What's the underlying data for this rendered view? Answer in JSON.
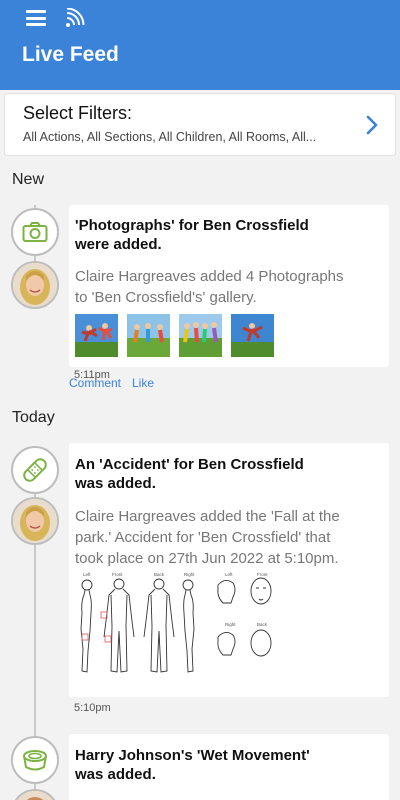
{
  "header": {
    "title": "Live Feed"
  },
  "filters": {
    "title": "Select Filters:",
    "summary": "All Actions, All Sections, All Children, All Rooms, All..."
  },
  "sections": {
    "new": "New",
    "today": "Today"
  },
  "feed": [
    {
      "title_line1": "'Photographs' for Ben Crossfield",
      "title_line2": "were added.",
      "text_line1": "Claire Hargreaves added 4 Photographs",
      "text_line2": "to 'Ben Crossfield's' gallery.",
      "time": "5:11pm",
      "comment_label": "Comment",
      "like_label": "Like"
    },
    {
      "title_line1": "An 'Accident' for Ben Crossfield",
      "title_line2": "was added.",
      "text_line1": "Claire Hargreaves added the 'Fall at the",
      "text_line2": "park.' Accident for 'Ben Crossfield' that",
      "text_line3": "took place on 27th Jun 2022 at 5:10pm.",
      "time": "5:10pm",
      "body_map_labels": [
        "Left",
        "Front",
        "Back",
        "Right",
        "Left",
        "Front",
        "Right",
        "Back"
      ]
    },
    {
      "title_line1": "Harry Johnson's 'Wet Movement'",
      "title_line2": "was added."
    }
  ],
  "colors": {
    "header": "#3b82d9",
    "accent_green": "#7cb342",
    "link": "#3b82d9"
  },
  "icons": [
    "menu-icon",
    "feed-icon",
    "chevron-right-icon",
    "camera-icon",
    "bandage-icon",
    "potty-icon",
    "avatar"
  ]
}
